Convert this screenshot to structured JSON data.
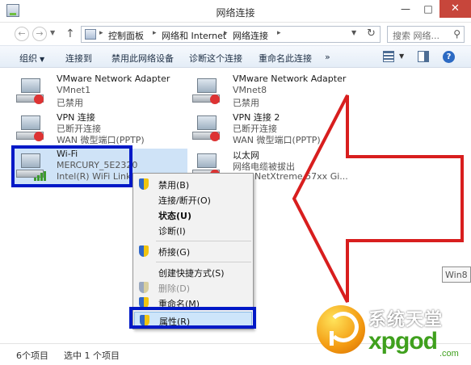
{
  "window": {
    "title": "网络连接",
    "min_label": "—",
    "max_label": "□",
    "close_label": "✕"
  },
  "address": {
    "back": "←",
    "forward": "→",
    "up": "↑",
    "crumbs": [
      "控制面板",
      "网络和 Internet",
      "网络连接"
    ],
    "separator": "▸",
    "search_placeholder": "搜索 网络..."
  },
  "toolbar": {
    "items": [
      "组织",
      "连接到",
      "禁用此网络设备",
      "诊断这个连接",
      "重命名此连接",
      "»"
    ]
  },
  "connections": [
    {
      "name": "VMware Network Adapter",
      "line2": "VMnet1",
      "line3": "已禁用",
      "icon": "disabled-adapter-icon"
    },
    {
      "name": "VMware Network Adapter",
      "line2": "VMnet8",
      "line3": "已禁用",
      "icon": "disabled-adapter-icon"
    },
    {
      "name": "VPN 连接",
      "line2": "已断开连接",
      "line3": "WAN 微型端口(PPTP)",
      "icon": "vpn-adapter-icon"
    },
    {
      "name": "VPN 连接 2",
      "line2": "已断开连接",
      "line3": "WAN 微型端口(PPTP)",
      "icon": "vpn-adapter-icon"
    },
    {
      "name": "Wi-Fi",
      "line2": "MERCURY_5E2320",
      "line3": "Intel(R) WiFi Link 5",
      "icon": "wifi-adapter-icon"
    },
    {
      "name": "以太网",
      "line2": "网络电缆被拔出",
      "line3": "com NetXtreme 57xx Gi...",
      "icon": "ethernet-adapter-icon"
    }
  ],
  "context_menu": {
    "items": [
      {
        "label": "禁用(B)",
        "icon": "shield-icon",
        "style": "normal"
      },
      {
        "label": "连接/断开(O)",
        "icon": "",
        "style": "normal"
      },
      {
        "label": "状态(U)",
        "icon": "",
        "style": "bold"
      },
      {
        "label": "诊断(I)",
        "icon": "",
        "style": "normal"
      },
      {
        "label": "桥接(G)",
        "icon": "shield-icon",
        "style": "normal"
      },
      {
        "label": "创建快捷方式(S)",
        "icon": "",
        "style": "normal"
      },
      {
        "label": "删除(D)",
        "icon": "shield-icon",
        "style": "disabled"
      },
      {
        "label": "重命名(M)",
        "icon": "shield-icon",
        "style": "normal"
      },
      {
        "label": "属性(R)",
        "icon": "shield-icon",
        "style": "highlighted"
      }
    ]
  },
  "status": {
    "item_count": "6个项目",
    "selected": "选中 1 个项目"
  },
  "tooltip_fragment": "Win8",
  "watermark": {
    "cn": "系统天堂",
    "en": "xpgod",
    "suffix": ".com"
  },
  "colors": {
    "annotation_red": "#d81e1e",
    "annotation_blue": "#0019c7",
    "selection": "#cfe3f7",
    "close_button": "#c7463b"
  }
}
